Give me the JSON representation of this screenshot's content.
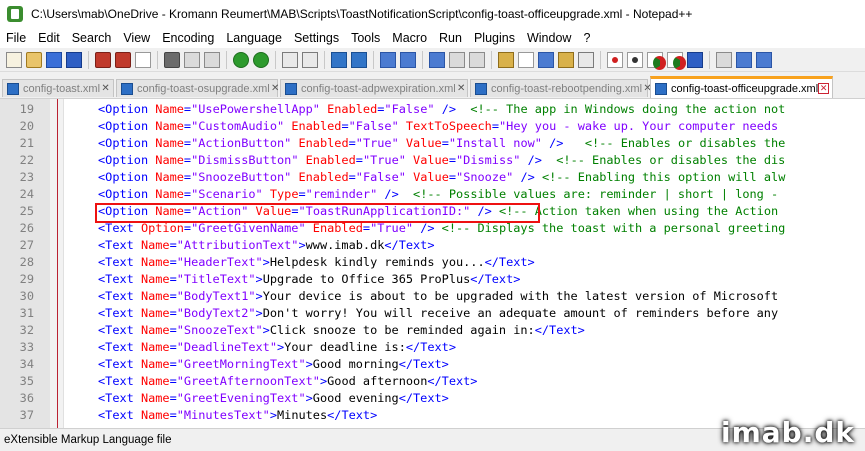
{
  "window": {
    "title": "C:\\Users\\mab\\OneDrive - Kromann Reumert\\MAB\\Scripts\\ToastNotificationScript\\config-toast-officeupgrade.xml - Notepad++"
  },
  "menu": [
    "File",
    "Edit",
    "Search",
    "View",
    "Encoding",
    "Language",
    "Settings",
    "Tools",
    "Macro",
    "Run",
    "Plugins",
    "Window",
    "?"
  ],
  "toolbar": {
    "icons": [
      "new-file-icon",
      "open-file-icon",
      "save-icon",
      "save-all-icon",
      "close-icon",
      "close-all-icon",
      "print-icon",
      "cut-icon",
      "copy-icon",
      "paste-icon",
      "undo-icon",
      "redo-icon",
      "find-icon",
      "replace-icon",
      "zoom-in-icon",
      "zoom-out-icon",
      "sync-vertical-icon",
      "sync-horizontal-icon",
      "word-wrap-icon",
      "show-all-chars-icon",
      "indent-guide-icon",
      "user-lang-icon",
      "doc-map-icon",
      "function-list-icon",
      "folder-workspace-icon",
      "monitoring-icon",
      "record-macro-icon",
      "stop-recording-icon",
      "playback-macro-icon",
      "run-macro-multiple-icon",
      "save-macro-icon",
      "plugin-icon",
      "compare-icon",
      "spell-check-icon"
    ]
  },
  "tabs": [
    {
      "label": "config-toast.xml",
      "active": false
    },
    {
      "label": "config-toast-osupgrade.xml",
      "active": false
    },
    {
      "label": "config-toast-adpwexpiration.xml",
      "active": false
    },
    {
      "label": "config-toast-rebootpending.xml",
      "active": false
    },
    {
      "label": "config-toast-officeupgrade.xml",
      "active": true
    }
  ],
  "editor": {
    "lines": [
      {
        "n": "19",
        "parts": [
          [
            "tag",
            "<Option "
          ],
          [
            "attr",
            "Name"
          ],
          [
            "tag",
            "="
          ],
          [
            "val",
            "\"UsePowershellApp\""
          ],
          [
            "attr",
            " Enabled"
          ],
          [
            "tag",
            "="
          ],
          [
            "val",
            "\"False\""
          ],
          [
            "tag",
            " />"
          ],
          [
            "cmt",
            "  <!-- The app in Windows doing the action not"
          ]
        ]
      },
      {
        "n": "20",
        "parts": [
          [
            "tag",
            "<Option "
          ],
          [
            "attr",
            "Name"
          ],
          [
            "tag",
            "="
          ],
          [
            "val",
            "\"CustomAudio\""
          ],
          [
            "attr",
            " Enabled"
          ],
          [
            "tag",
            "="
          ],
          [
            "val",
            "\"False\""
          ],
          [
            "attr",
            " TextToSpeech"
          ],
          [
            "tag",
            "="
          ],
          [
            "val",
            "\"Hey you - wake up. Your computer needs"
          ]
        ]
      },
      {
        "n": "21",
        "parts": [
          [
            "tag",
            "<Option "
          ],
          [
            "attr",
            "Name"
          ],
          [
            "tag",
            "="
          ],
          [
            "val",
            "\"ActionButton\""
          ],
          [
            "attr",
            " Enabled"
          ],
          [
            "tag",
            "="
          ],
          [
            "val",
            "\"True\""
          ],
          [
            "attr",
            " Value"
          ],
          [
            "tag",
            "="
          ],
          [
            "val",
            "\"Install now\""
          ],
          [
            "tag",
            " />"
          ],
          [
            "cmt",
            "   <!-- Enables or disables the"
          ]
        ]
      },
      {
        "n": "22",
        "parts": [
          [
            "tag",
            "<Option "
          ],
          [
            "attr",
            "Name"
          ],
          [
            "tag",
            "="
          ],
          [
            "val",
            "\"DismissButton\""
          ],
          [
            "attr",
            " Enabled"
          ],
          [
            "tag",
            "="
          ],
          [
            "val",
            "\"True\""
          ],
          [
            "attr",
            " Value"
          ],
          [
            "tag",
            "="
          ],
          [
            "val",
            "\"Dismiss\""
          ],
          [
            "tag",
            " />"
          ],
          [
            "cmt",
            "  <!-- Enables or disables the dis"
          ]
        ]
      },
      {
        "n": "23",
        "parts": [
          [
            "tag",
            "<Option "
          ],
          [
            "attr",
            "Name"
          ],
          [
            "tag",
            "="
          ],
          [
            "val",
            "\"SnoozeButton\""
          ],
          [
            "attr",
            " Enabled"
          ],
          [
            "tag",
            "="
          ],
          [
            "val",
            "\"False\""
          ],
          [
            "attr",
            " Value"
          ],
          [
            "tag",
            "="
          ],
          [
            "val",
            "\"Snooze\""
          ],
          [
            "tag",
            " />"
          ],
          [
            "cmt",
            " <!-- Enabling this option will alw"
          ]
        ]
      },
      {
        "n": "24",
        "parts": [
          [
            "tag",
            "<Option "
          ],
          [
            "attr",
            "Name"
          ],
          [
            "tag",
            "="
          ],
          [
            "val",
            "\"Scenario\""
          ],
          [
            "attr",
            " Type"
          ],
          [
            "tag",
            "="
          ],
          [
            "val",
            "\"reminder\""
          ],
          [
            "tag",
            " />"
          ],
          [
            "cmt",
            "  <!-- Possible values are: reminder | short | long -"
          ]
        ]
      },
      {
        "n": "25",
        "parts": [
          [
            "tag",
            "<Option "
          ],
          [
            "attr",
            "Name"
          ],
          [
            "tag",
            "="
          ],
          [
            "val",
            "\"Action\""
          ],
          [
            "attr",
            " Value"
          ],
          [
            "tag",
            "="
          ],
          [
            "val",
            "\"ToastRunApplicationID:\""
          ],
          [
            "tag",
            " />"
          ],
          [
            "cmt",
            " <!-- Action taken when using the Action"
          ]
        ]
      },
      {
        "n": "26",
        "parts": [
          [
            "tag",
            "<Text "
          ],
          [
            "attr",
            "Option"
          ],
          [
            "tag",
            "="
          ],
          [
            "val",
            "\"GreetGivenName\""
          ],
          [
            "attr",
            " Enabled"
          ],
          [
            "tag",
            "="
          ],
          [
            "val",
            "\"True\""
          ],
          [
            "tag",
            " />"
          ],
          [
            "cmt",
            " <!-- Displays the toast with a personal greeting"
          ]
        ]
      },
      {
        "n": "27",
        "parts": [
          [
            "tag",
            "<Text "
          ],
          [
            "attr",
            "Name"
          ],
          [
            "tag",
            "="
          ],
          [
            "val",
            "\"AttributionText\""
          ],
          [
            "tag",
            ">"
          ],
          [
            "txt",
            "www.imab.dk"
          ],
          [
            "tag",
            "</Text>"
          ]
        ]
      },
      {
        "n": "28",
        "parts": [
          [
            "tag",
            "<Text "
          ],
          [
            "attr",
            "Name"
          ],
          [
            "tag",
            "="
          ],
          [
            "val",
            "\"HeaderText\""
          ],
          [
            "tag",
            ">"
          ],
          [
            "txt",
            "Helpdesk kindly reminds you..."
          ],
          [
            "tag",
            "</Text>"
          ]
        ]
      },
      {
        "n": "29",
        "parts": [
          [
            "tag",
            "<Text "
          ],
          [
            "attr",
            "Name"
          ],
          [
            "tag",
            "="
          ],
          [
            "val",
            "\"TitleText\""
          ],
          [
            "tag",
            ">"
          ],
          [
            "txt",
            "Upgrade to Office 365 ProPlus"
          ],
          [
            "tag",
            "</Text>"
          ]
        ]
      },
      {
        "n": "30",
        "parts": [
          [
            "tag",
            "<Text "
          ],
          [
            "attr",
            "Name"
          ],
          [
            "tag",
            "="
          ],
          [
            "val",
            "\"BodyText1\""
          ],
          [
            "tag",
            ">"
          ],
          [
            "txt",
            "Your device is about to be upgraded with the latest version of Microsoft"
          ]
        ]
      },
      {
        "n": "31",
        "parts": [
          [
            "tag",
            "<Text "
          ],
          [
            "attr",
            "Name"
          ],
          [
            "tag",
            "="
          ],
          [
            "val",
            "\"BodyText2\""
          ],
          [
            "tag",
            ">"
          ],
          [
            "txt",
            "Don't worry! You will receive an adequate amount of reminders before any"
          ]
        ]
      },
      {
        "n": "32",
        "parts": [
          [
            "tag",
            "<Text "
          ],
          [
            "attr",
            "Name"
          ],
          [
            "tag",
            "="
          ],
          [
            "val",
            "\"SnoozeText\""
          ],
          [
            "tag",
            ">"
          ],
          [
            "txt",
            "Click snooze to be reminded again in:"
          ],
          [
            "tag",
            "</Text>"
          ]
        ]
      },
      {
        "n": "33",
        "parts": [
          [
            "tag",
            "<Text "
          ],
          [
            "attr",
            "Name"
          ],
          [
            "tag",
            "="
          ],
          [
            "val",
            "\"DeadlineText\""
          ],
          [
            "tag",
            ">"
          ],
          [
            "txt",
            "Your deadline is:"
          ],
          [
            "tag",
            "</Text>"
          ]
        ]
      },
      {
        "n": "34",
        "parts": [
          [
            "tag",
            "<Text "
          ],
          [
            "attr",
            "Name"
          ],
          [
            "tag",
            "="
          ],
          [
            "val",
            "\"GreetMorningText\""
          ],
          [
            "tag",
            ">"
          ],
          [
            "txt",
            "Good morning"
          ],
          [
            "tag",
            "</Text>"
          ]
        ]
      },
      {
        "n": "35",
        "parts": [
          [
            "tag",
            "<Text "
          ],
          [
            "attr",
            "Name"
          ],
          [
            "tag",
            "="
          ],
          [
            "val",
            "\"GreetAfternoonText\""
          ],
          [
            "tag",
            ">"
          ],
          [
            "txt",
            "Good afternoon"
          ],
          [
            "tag",
            "</Text>"
          ]
        ]
      },
      {
        "n": "36",
        "parts": [
          [
            "tag",
            "<Text "
          ],
          [
            "attr",
            "Name"
          ],
          [
            "tag",
            "="
          ],
          [
            "val",
            "\"GreetEveningText\""
          ],
          [
            "tag",
            ">"
          ],
          [
            "txt",
            "Good evening"
          ],
          [
            "tag",
            "</Text>"
          ]
        ]
      },
      {
        "n": "37",
        "parts": [
          [
            "tag",
            "<Text "
          ],
          [
            "attr",
            "Name"
          ],
          [
            "tag",
            "="
          ],
          [
            "val",
            "\"MinutesText\""
          ],
          [
            "tag",
            ">"
          ],
          [
            "txt",
            "Minutes"
          ],
          [
            "tag",
            "</Text>"
          ]
        ]
      }
    ]
  },
  "status": {
    "file_type": "eXtensible Markup Language file"
  },
  "watermark": {
    "text": "imab.dk"
  }
}
